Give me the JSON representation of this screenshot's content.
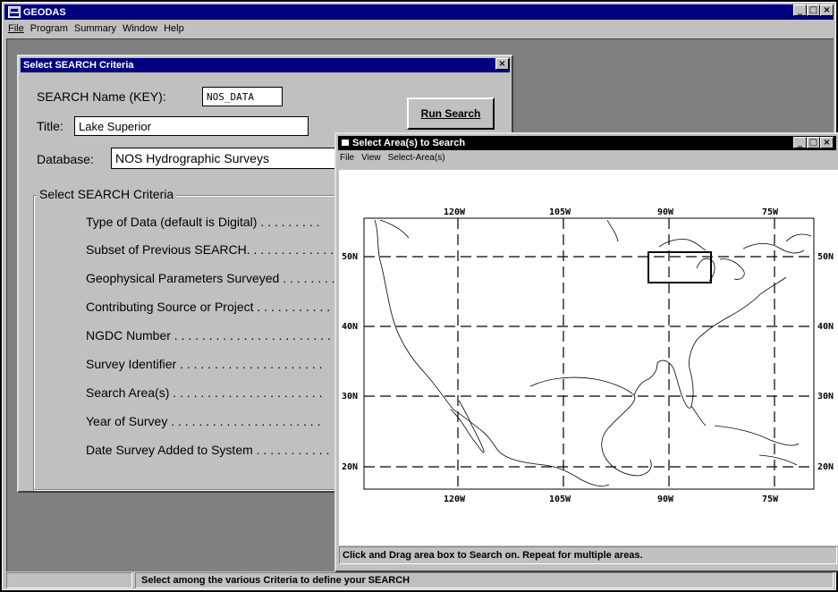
{
  "app": {
    "title": "GEODAS",
    "menu": [
      "File",
      "Program",
      "Summary",
      "Window",
      "Help"
    ]
  },
  "criteria_dialog": {
    "title": "Select SEARCH Criteria",
    "search_name_label": "SEARCH Name  (KEY):",
    "search_name_value": "NOS_DATA",
    "run_button": "Run Search",
    "title_label": "Title:",
    "title_value": "Lake Superior",
    "database_label": "Database:",
    "database_value": "NOS Hydrographic Surveys",
    "group_label": "Select SEARCH Criteria",
    "criteria": [
      "Type of Data (default is Digital) . . . . . . . . .",
      "Subset of Previous SEARCH. . . . . . . . . . . . .",
      "Geophysical Parameters Surveyed  . . . . . . . .",
      "Contributing Source or Project . . . . . . . . . . .",
      "NGDC Number . . . . . . . . . . . . . . . . . . . . . . .",
      "Survey Identifier . . . . . . . . . . . . . . . . . . . . .",
      "Search Area(s) . . . . . . . . . . . . . . . . . . . . . .",
      "Year of Survey . . . . . . . . . . . . . . . . . . . . . .",
      "Date Survey Added to System . . . . . . . . . . ."
    ]
  },
  "map_window": {
    "title": "Select Area(s) to Search",
    "menu": [
      "File",
      "View",
      "Select-Area(s)"
    ],
    "lon_labels": [
      "120W",
      "105W",
      "90W",
      "75W"
    ],
    "lat_labels": [
      "50N",
      "40N",
      "30N",
      "20N"
    ],
    "status": "Click and Drag area box to Search on.  Repeat for multiple areas."
  },
  "statusbar": {
    "message": "Select among the various Criteria to define your SEARCH"
  }
}
